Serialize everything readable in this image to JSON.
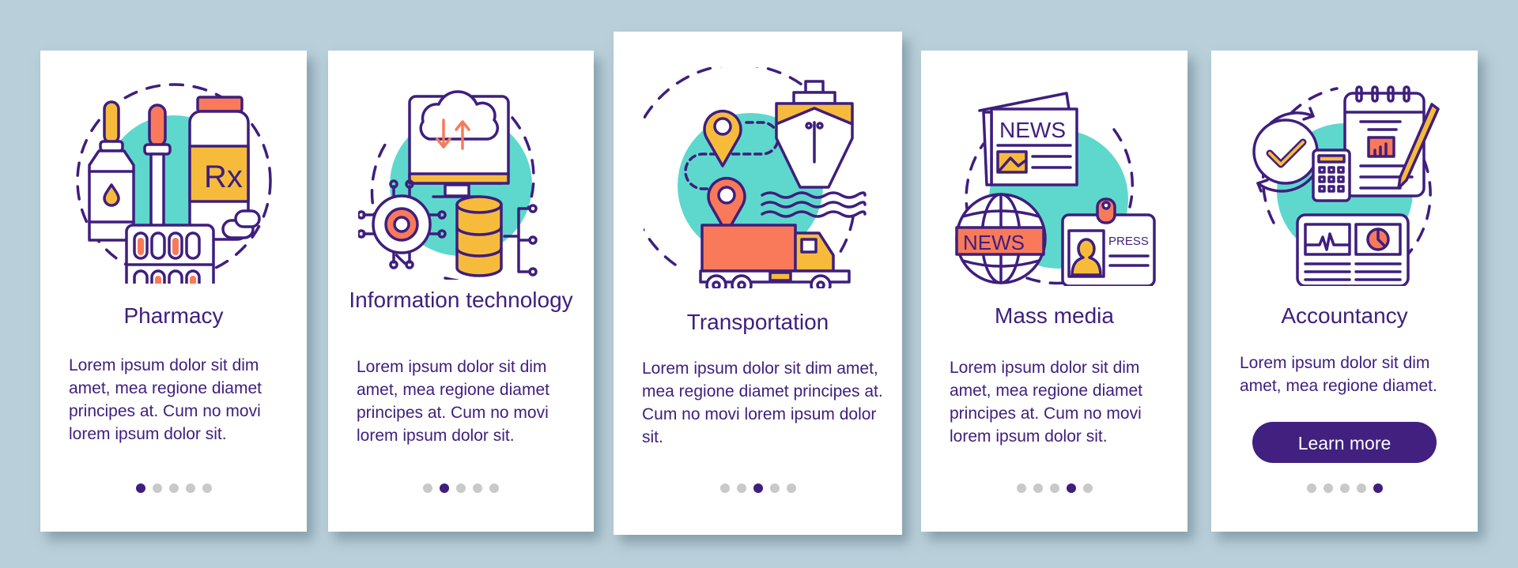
{
  "colors": {
    "background": "#b9cfd9",
    "primary": "#3f1e7e",
    "accent_teal": "#5ed8cc",
    "accent_orange": "#f97a5a",
    "accent_yellow": "#f7bb3b",
    "dot_inactive": "#c9c9c9"
  },
  "pagination_total": 5,
  "cards": [
    {
      "illustration": "pharmacy-icon",
      "title": "Pharmacy",
      "body": "Lorem ipsum dolor sit dim amet, mea regione diamet principes at. Cum no movi lorem ipsum dolor sit.",
      "active_page": 1,
      "labels": {
        "rx": "Rx"
      }
    },
    {
      "illustration": "information-technology-icon",
      "title": "Information technology",
      "body": "Lorem ipsum dolor sit dim amet, mea regione diamet principes at. Cum no movi lorem ipsum dolor sit.",
      "active_page": 2
    },
    {
      "illustration": "transportation-icon",
      "title": "Transportation",
      "body": "Lorem ipsum dolor sit dim amet, mea regione diamet principes at. Cum no movi lorem ipsum dolor sit.",
      "active_page": 3
    },
    {
      "illustration": "mass-media-icon",
      "title": "Mass media",
      "body": "Lorem ipsum dolor sit dim amet, mea regione diamet principes at. Cum no movi lorem ipsum dolor sit.",
      "active_page": 4,
      "labels": {
        "newspaper": "NEWS",
        "globe_banner": "NEWS",
        "badge": "PRESS"
      }
    },
    {
      "illustration": "accountancy-icon",
      "title": "Accountancy",
      "body": "Lorem ipsum dolor sit dim amet, mea regione diamet.",
      "active_page": 5,
      "button_label": "Learn more"
    }
  ]
}
